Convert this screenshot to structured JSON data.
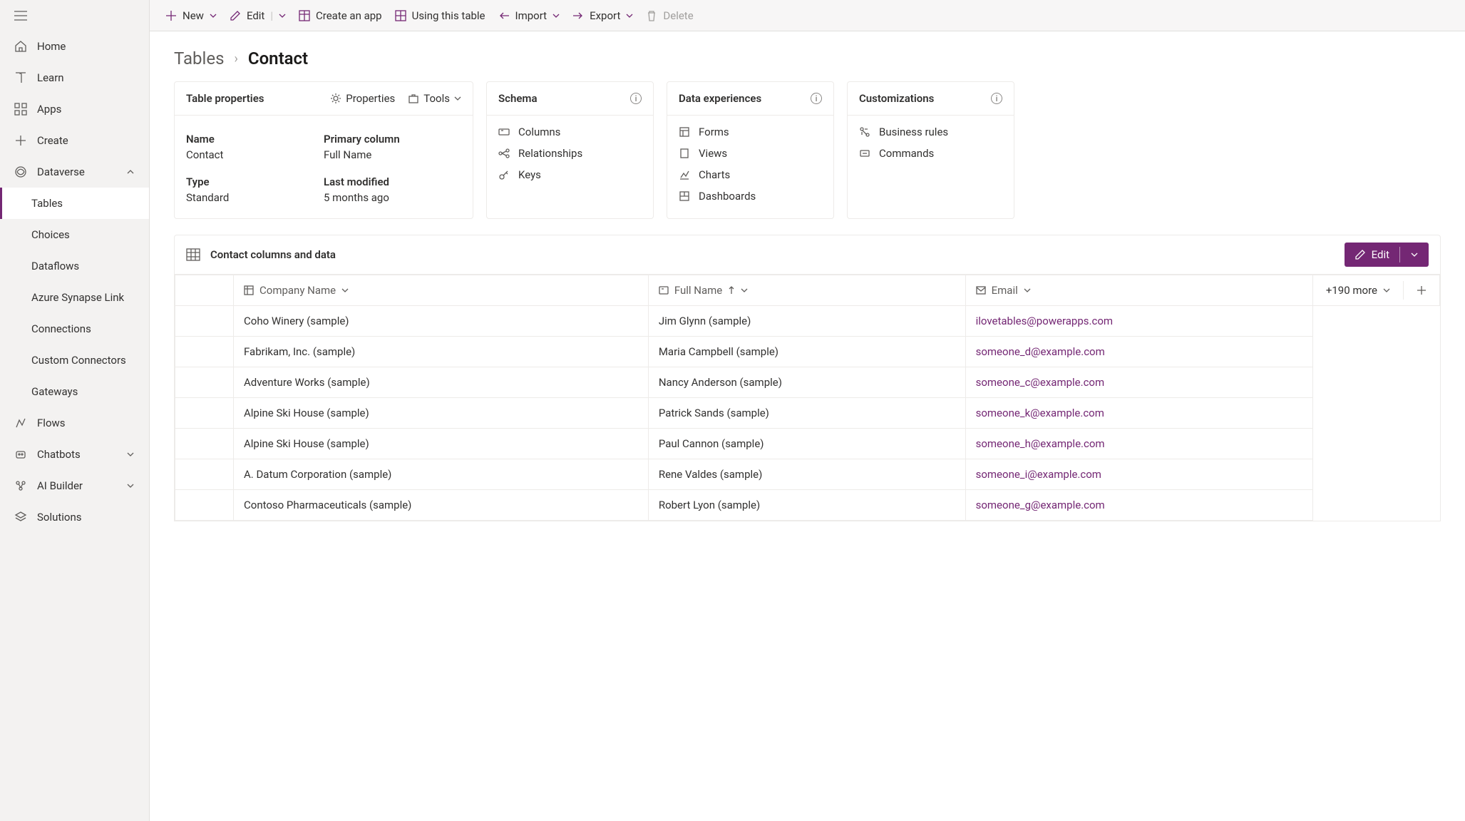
{
  "sidebar": {
    "items": [
      {
        "label": "Home"
      },
      {
        "label": "Learn"
      },
      {
        "label": "Apps"
      },
      {
        "label": "Create"
      },
      {
        "label": "Dataverse",
        "expanded": true,
        "children": [
          {
            "label": "Tables",
            "selected": true
          },
          {
            "label": "Choices"
          },
          {
            "label": "Dataflows"
          },
          {
            "label": "Azure Synapse Link"
          },
          {
            "label": "Connections"
          },
          {
            "label": "Custom Connectors"
          },
          {
            "label": "Gateways"
          }
        ]
      },
      {
        "label": "Flows"
      },
      {
        "label": "Chatbots"
      },
      {
        "label": "AI Builder"
      },
      {
        "label": "Solutions"
      }
    ]
  },
  "cmdbar": {
    "new": "New",
    "edit": "Edit",
    "create_app": "Create an app",
    "using_table": "Using this table",
    "import": "Import",
    "export": "Export",
    "delete": "Delete"
  },
  "breadcrumb": {
    "root": "Tables",
    "leaf": "Contact"
  },
  "card_props": {
    "title": "Table properties",
    "btn_props": "Properties",
    "btn_tools": "Tools",
    "k_name": "Name",
    "v_name": "Contact",
    "k_primary": "Primary column",
    "v_primary": "Full Name",
    "k_type": "Type",
    "v_type": "Standard",
    "k_mod": "Last modified",
    "v_mod": "5 months ago"
  },
  "card_schema": {
    "title": "Schema",
    "links": [
      "Columns",
      "Relationships",
      "Keys"
    ]
  },
  "card_exp": {
    "title": "Data experiences",
    "links": [
      "Forms",
      "Views",
      "Charts",
      "Dashboards"
    ]
  },
  "card_cust": {
    "title": "Customizations",
    "links": [
      "Business rules",
      "Commands"
    ]
  },
  "data_section": {
    "title": "Contact columns and data",
    "edit_label": "Edit",
    "more_label": "+190 more",
    "columns": [
      "Company Name",
      "Full Name",
      "Email"
    ],
    "rows": [
      {
        "company": "Coho Winery (sample)",
        "name": "Jim Glynn (sample)",
        "email": "ilovetables@powerapps.com"
      },
      {
        "company": "Fabrikam, Inc. (sample)",
        "name": "Maria Campbell (sample)",
        "email": "someone_d@example.com"
      },
      {
        "company": "Adventure Works (sample)",
        "name": "Nancy Anderson (sample)",
        "email": "someone_c@example.com"
      },
      {
        "company": "Alpine Ski House (sample)",
        "name": "Patrick Sands (sample)",
        "email": "someone_k@example.com"
      },
      {
        "company": "Alpine Ski House (sample)",
        "name": "Paul Cannon (sample)",
        "email": "someone_h@example.com"
      },
      {
        "company": "A. Datum Corporation (sample)",
        "name": "Rene Valdes (sample)",
        "email": "someone_i@example.com"
      },
      {
        "company": "Contoso Pharmaceuticals (sample)",
        "name": "Robert Lyon (sample)",
        "email": "someone_g@example.com"
      }
    ]
  }
}
